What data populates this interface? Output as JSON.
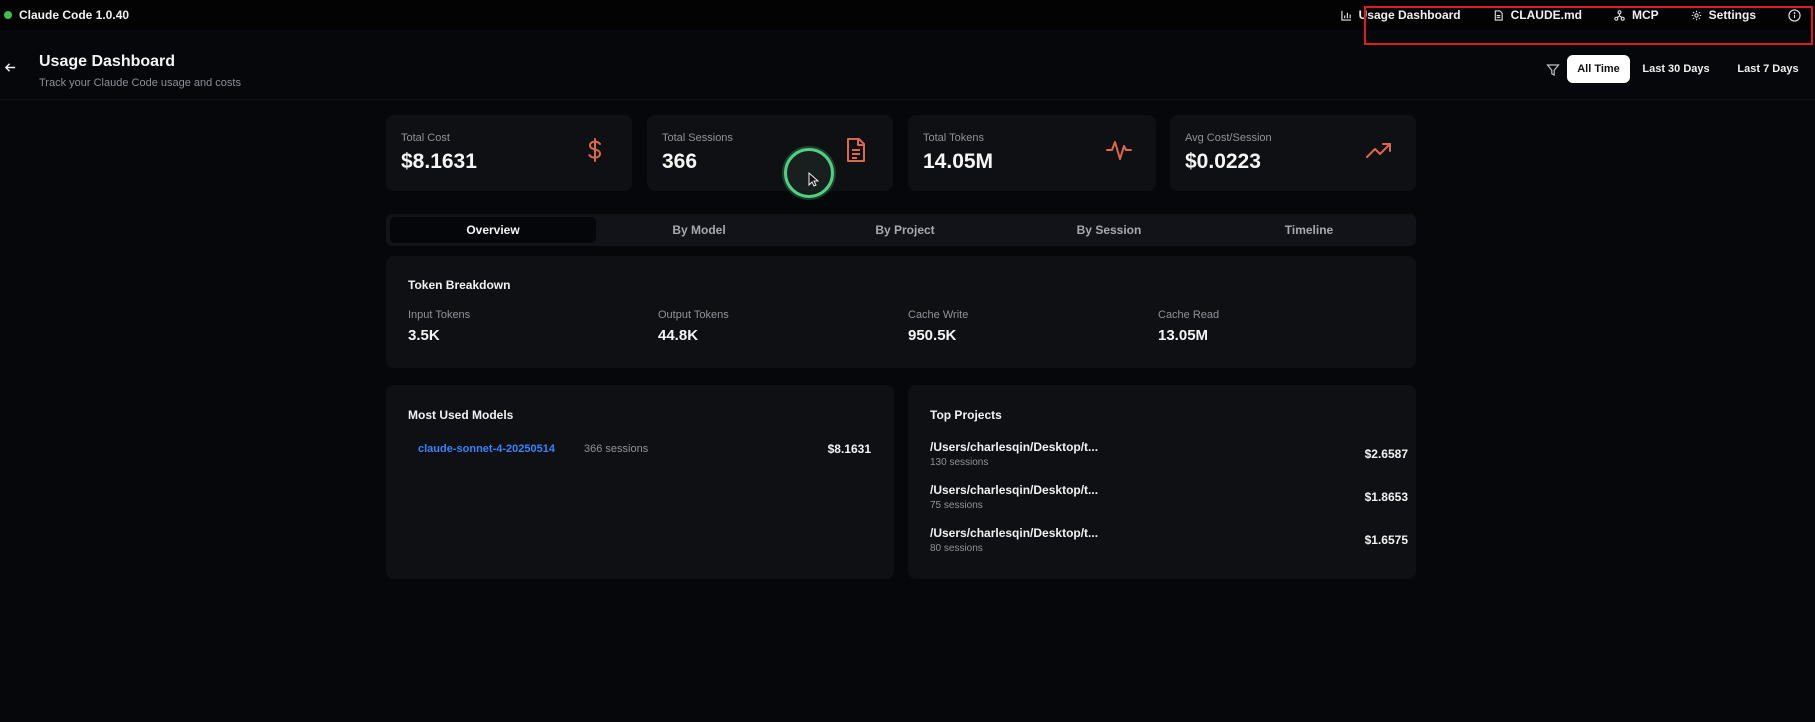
{
  "app": {
    "title": "Claude Code 1.0.40",
    "status_color": "#3fbf4f"
  },
  "topnav": {
    "items": [
      {
        "label": "Usage Dashboard",
        "icon": "bar-chart-icon"
      },
      {
        "label": "CLAUDE.md",
        "icon": "file-icon"
      },
      {
        "label": "MCP",
        "icon": "network-icon"
      },
      {
        "label": "Settings",
        "icon": "gear-icon"
      }
    ],
    "info_icon": "info-icon"
  },
  "header": {
    "title": "Usage Dashboard",
    "subtitle": "Track your Claude Code usage and costs",
    "ranges": [
      {
        "label": "All Time",
        "active": true
      },
      {
        "label": "Last 30 Days",
        "active": false
      },
      {
        "label": "Last 7 Days",
        "active": false
      }
    ]
  },
  "stats": [
    {
      "label": "Total Cost",
      "value": "$8.1631",
      "icon": "dollar-icon"
    },
    {
      "label": "Total Sessions",
      "value": "366",
      "icon": "document-icon"
    },
    {
      "label": "Total Tokens",
      "value": "14.05M",
      "icon": "activity-icon"
    },
    {
      "label": "Avg Cost/Session",
      "value": "$0.0223",
      "icon": "trending-up-icon"
    }
  ],
  "accent_color": "#d9694a",
  "tabs": [
    {
      "label": "Overview",
      "active": true
    },
    {
      "label": "By Model",
      "active": false
    },
    {
      "label": "By Project",
      "active": false
    },
    {
      "label": "By Session",
      "active": false
    },
    {
      "label": "Timeline",
      "active": false
    }
  ],
  "token_breakdown": {
    "title": "Token Breakdown",
    "items": [
      {
        "label": "Input Tokens",
        "value": "3.5K"
      },
      {
        "label": "Output Tokens",
        "value": "44.8K"
      },
      {
        "label": "Cache Write",
        "value": "950.5K"
      },
      {
        "label": "Cache Read",
        "value": "13.05M"
      }
    ]
  },
  "models": {
    "title": "Most Used Models",
    "items": [
      {
        "name": "claude-sonnet-4-20250514",
        "sessions": "366 sessions",
        "cost": "$8.1631"
      }
    ]
  },
  "projects": {
    "title": "Top Projects",
    "items": [
      {
        "path": "/Users/charlesqin/Desktop/t...",
        "sessions": "130 sessions",
        "cost": "$2.6587"
      },
      {
        "path": "/Users/charlesqin/Desktop/t...",
        "sessions": "75 sessions",
        "cost": "$1.8653"
      },
      {
        "path": "/Users/charlesqin/Desktop/t...",
        "sessions": "80 sessions",
        "cost": "$1.6575"
      }
    ]
  }
}
